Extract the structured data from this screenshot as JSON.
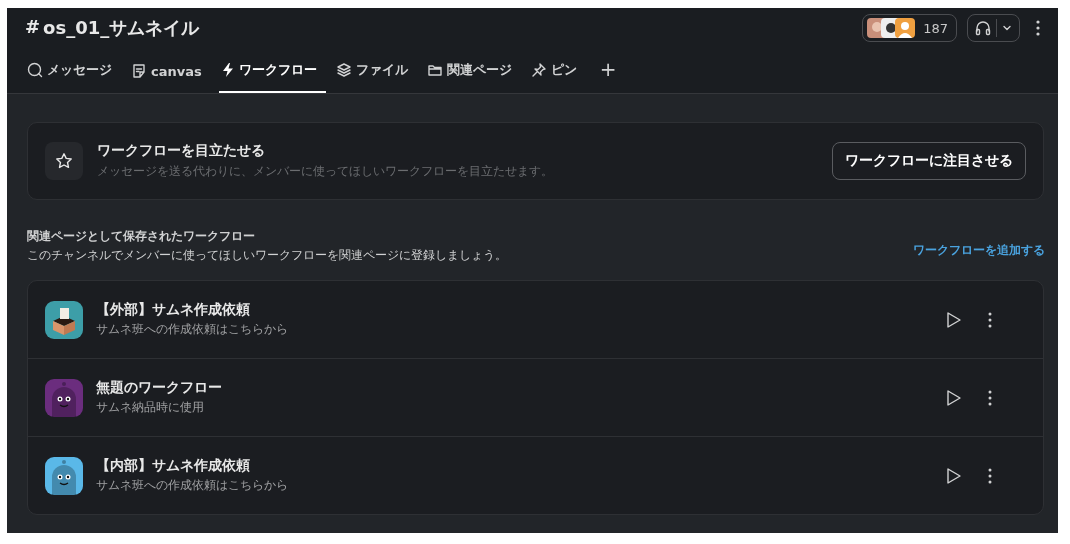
{
  "channel": {
    "hash": "#",
    "name": "os_01_サムネイル",
    "member_count": "187"
  },
  "tabs": [
    {
      "kind": "messages",
      "label": "メッセージ",
      "selected": false
    },
    {
      "kind": "canvas",
      "label": "canvas",
      "selected": false
    },
    {
      "kind": "workflows",
      "label": "ワークフロー",
      "selected": true
    },
    {
      "kind": "files",
      "label": "ファイル",
      "selected": false
    },
    {
      "kind": "bookmarks",
      "label": "関連ページ",
      "selected": false
    },
    {
      "kind": "pins",
      "label": "ピン",
      "selected": false
    }
  ],
  "add_tab": "+",
  "feature_card": {
    "title": "ワークフローを目立たせる",
    "description": "メッセージを送る代わりに、メンバーに使ってほしいワークフローを目立たせます。",
    "button": "ワークフローに注目させる"
  },
  "section": {
    "title": "関連ページとして保存されたワークフロー",
    "description": "このチャンネルでメンバーに使ってほしいワークフローを関連ページに登録しましょう。",
    "link": "ワークフローを追加する"
  },
  "workflows": [
    {
      "kind": "box",
      "color": "#3d9ea8",
      "name": "【外部】サムネ作成依頼",
      "description": "サムネ班への作成依頼はこちらから"
    },
    {
      "kind": "robot",
      "color": "#6b2d7e",
      "name": "無題のワークフロー",
      "description": "サムネ納品時に使用"
    },
    {
      "kind": "robot",
      "color": "#5ab8e8",
      "name": "【内部】サムネ作成依頼",
      "description": "サムネ班への作成依頼はこちらから"
    }
  ]
}
